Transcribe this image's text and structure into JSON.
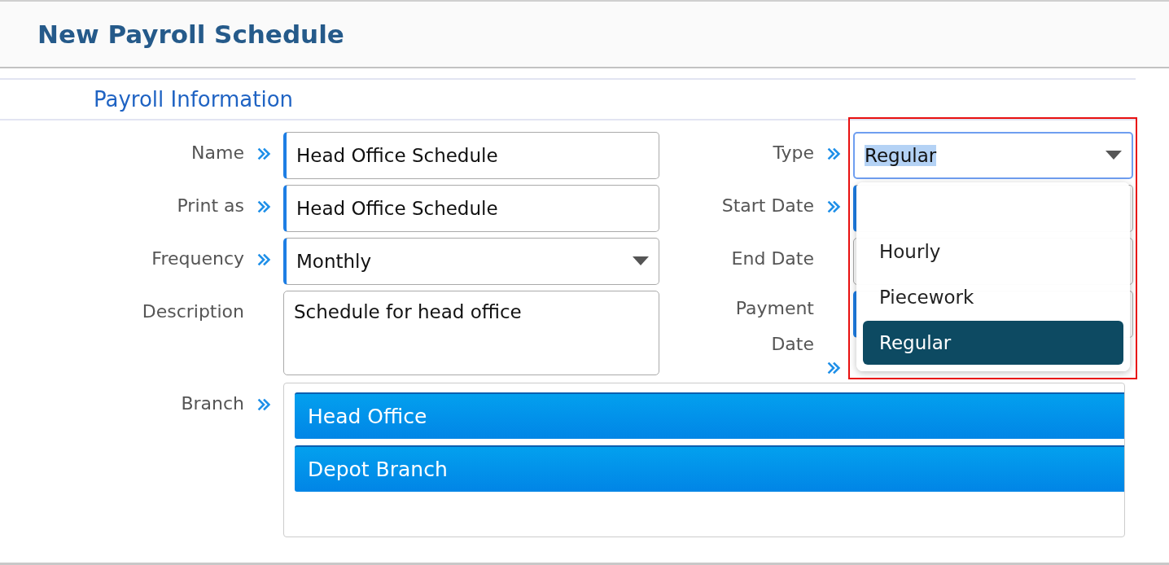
{
  "title": "New Payroll Schedule",
  "section": "Payroll Information",
  "left_fields": [
    {
      "label": "Name",
      "required": true,
      "kind": "text",
      "value": "Head Office Schedule"
    },
    {
      "label": "Print as",
      "required": true,
      "kind": "text",
      "value": "Head Office Schedule"
    },
    {
      "label": "Frequency",
      "required": true,
      "kind": "select",
      "value": "Monthly"
    },
    {
      "label": "Description",
      "required": false,
      "kind": "textarea",
      "value": "Schedule for head office"
    }
  ],
  "type_field": {
    "label": "Type",
    "required": true,
    "value": "Regular",
    "expanded": true,
    "options": [
      {
        "label": "Hourly",
        "selected": false
      },
      {
        "label": "Piecework",
        "selected": false
      },
      {
        "label": "Regular",
        "selected": true
      }
    ]
  },
  "date_fields": [
    {
      "label": "Start Date",
      "required": true
    },
    {
      "label": "End Date",
      "required": false
    },
    {
      "label": "Payment Date",
      "required": true
    }
  ],
  "branch": {
    "label": "Branch",
    "required": true,
    "items": [
      {
        "label": "Head Office",
        "selected": true
      },
      {
        "label": "Depot Branch",
        "selected": true
      }
    ]
  }
}
